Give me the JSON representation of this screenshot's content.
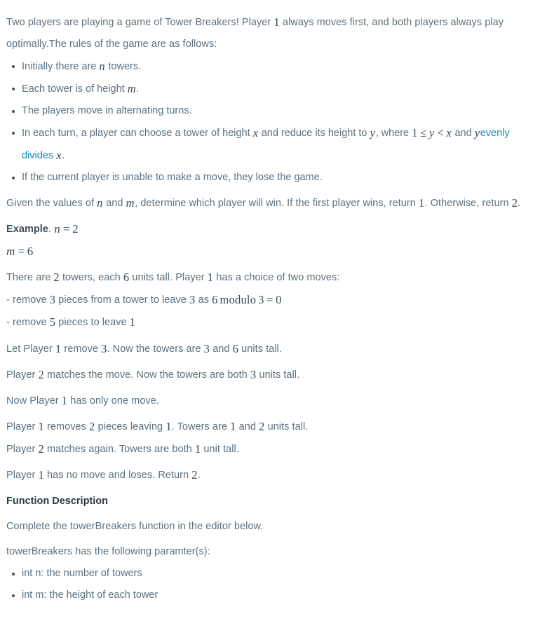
{
  "document": {
    "type": "coding-challenge-problem-statement",
    "intro": {
      "p1_seg1": "Two players are playing a game of Tower Breakers! Player ",
      "p1_math1": "1",
      "p1_seg2": " always moves first, and both players always play optimally.The rules of the game are as follows:"
    },
    "rules": [
      {
        "seg1": "Initially there are ",
        "math1": "n",
        "seg2": " towers."
      },
      {
        "seg1": "Each tower is of height ",
        "math1": "m",
        "seg2": "."
      },
      {
        "seg1": "The players move in alternating turns.",
        "math1": "",
        "seg2": ""
      },
      {
        "seg1": "In each turn, a player can choose a tower of height ",
        "math1": "x",
        "seg2": " and reduce its height to ",
        "math2": "y",
        "seg3": ", where ",
        "math3": "1 ≤ y < x",
        "seg4": " and ",
        "math4": "y",
        "link": "evenly divides",
        "math5": "x",
        "seg5": "."
      },
      {
        "seg1": "If the current player is unable to make a move, they lose the game.",
        "math1": "",
        "seg2": ""
      }
    ],
    "objective": {
      "seg1": "Given the values of ",
      "math1": "n",
      "seg2": " and ",
      "math2": "m",
      "seg3": ", determine which player will win. If the first player wins, return ",
      "math3": "1",
      "seg4": ". Otherwise, return ",
      "math4": "2",
      "seg5": "."
    },
    "example": {
      "label": "Example",
      "label_suffix": ".",
      "n_assignment": "n = 2",
      "m_assignment": "m = 6",
      "lines": [
        {
          "s1": "There are ",
          "m1": "2",
          "s2": " towers, each ",
          "m2": "6",
          "s3": " units tall. Player ",
          "m3": "1",
          "s4": " has a choice of two moves:"
        },
        {
          "s1": "- remove ",
          "m1": "3",
          "s2": " pieces from a tower to leave ",
          "m2": "3",
          "s3": " as ",
          "m3": "6 modulo 3 = 0",
          "s4": ""
        },
        {
          "s1": "- remove ",
          "m1": "5",
          "s2": " pieces to leave ",
          "m2": "1",
          "s3": "",
          "m3": "",
          "s4": ""
        },
        {
          "s1": "Let Player ",
          "m1": "1",
          "s2": " remove ",
          "m2": "3",
          "s3": ". Now the towers are ",
          "m3": "3",
          "s4": " and ",
          "m4": "6",
          "s5": " units tall."
        },
        {
          "s1": "Player ",
          "m1": "2",
          "s2": " matches the move. Now the towers are both ",
          "m2": "3",
          "s3": " units tall."
        },
        {
          "s1": "Now Player ",
          "m1": "1",
          "s2": " has only one move."
        },
        {
          "s1": "Player ",
          "m1": "1",
          "s2": " removes ",
          "m2": "2",
          "s3": " pieces leaving ",
          "m3": "1",
          "s4": ". Towers are ",
          "m4": "1",
          "s5": " and ",
          "m5": "2",
          "s6": " units tall."
        },
        {
          "s1": "Player ",
          "m1": "2",
          "s2": " matches again. Towers are both ",
          "m2": "1",
          "s3": " unit tall."
        },
        {
          "s1": "Player ",
          "m1": "1",
          "s2": " has no move and loses. Return ",
          "m2": "2",
          "s3": "."
        }
      ]
    },
    "function_description": {
      "heading": "Function Description",
      "line1": "Complete the towerBreakers function in the editor below.",
      "line2": "towerBreakers has the following paramter(s):",
      "params": [
        "int n: the number of towers",
        "int m: the height of each tower"
      ]
    },
    "colors": {
      "body_text": "#5c7080",
      "math_text": "#3b4a55",
      "heading_text": "#2b3a44",
      "link": "#1a8bc4",
      "bullet": "#44566a",
      "background": "#ffffff"
    }
  }
}
